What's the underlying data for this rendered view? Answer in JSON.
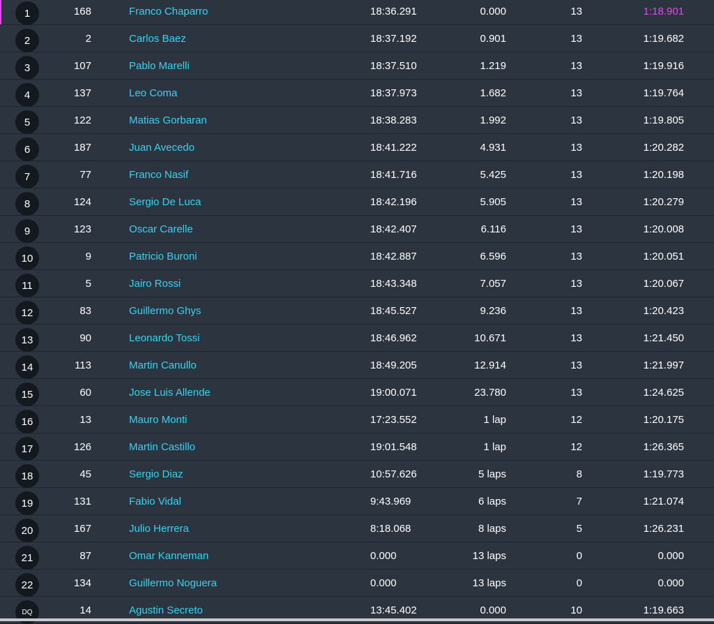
{
  "colors": {
    "background": "#2c3440",
    "driver_name": "#35d3f0",
    "fastest_lap": "#e844e8",
    "position_badge": "#141920"
  },
  "results": [
    {
      "pos": "1",
      "number": "168",
      "driver": "Franco Chaparro",
      "time": "18:36.291",
      "gap": "0.000",
      "laps": "13",
      "best_lap": "1:18.901",
      "fastest": true
    },
    {
      "pos": "2",
      "number": "2",
      "driver": "Carlos Baez",
      "time": "18:37.192",
      "gap": "0.901",
      "laps": "13",
      "best_lap": "1:19.682"
    },
    {
      "pos": "3",
      "number": "107",
      "driver": "Pablo Marelli",
      "time": "18:37.510",
      "gap": "1.219",
      "laps": "13",
      "best_lap": "1:19.916"
    },
    {
      "pos": "4",
      "number": "137",
      "driver": "Leo Coma",
      "time": "18:37.973",
      "gap": "1.682",
      "laps": "13",
      "best_lap": "1:19.764"
    },
    {
      "pos": "5",
      "number": "122",
      "driver": "Matias Gorbaran",
      "time": "18:38.283",
      "gap": "1.992",
      "laps": "13",
      "best_lap": "1:19.805"
    },
    {
      "pos": "6",
      "number": "187",
      "driver": "Juan Avecedo",
      "time": "18:41.222",
      "gap": "4.931",
      "laps": "13",
      "best_lap": "1:20.282"
    },
    {
      "pos": "7",
      "number": "77",
      "driver": "Franco Nasif",
      "time": "18:41.716",
      "gap": "5.425",
      "laps": "13",
      "best_lap": "1:20.198"
    },
    {
      "pos": "8",
      "number": "124",
      "driver": "Sergio De Luca",
      "time": "18:42.196",
      "gap": "5.905",
      "laps": "13",
      "best_lap": "1:20.279"
    },
    {
      "pos": "9",
      "number": "123",
      "driver": "Oscar Carelle",
      "time": "18:42.407",
      "gap": "6.116",
      "laps": "13",
      "best_lap": "1:20.008"
    },
    {
      "pos": "10",
      "number": "9",
      "driver": "Patricio Buroni",
      "time": "18:42.887",
      "gap": "6.596",
      "laps": "13",
      "best_lap": "1:20.051"
    },
    {
      "pos": "11",
      "number": "5",
      "driver": "Jairo Rossi",
      "time": "18:43.348",
      "gap": "7.057",
      "laps": "13",
      "best_lap": "1:20.067"
    },
    {
      "pos": "12",
      "number": "83",
      "driver": "Guillermo Ghys",
      "time": "18:45.527",
      "gap": "9.236",
      "laps": "13",
      "best_lap": "1:20.423"
    },
    {
      "pos": "13",
      "number": "90",
      "driver": "Leonardo Tossi",
      "time": "18:46.962",
      "gap": "10.671",
      "laps": "13",
      "best_lap": "1:21.450"
    },
    {
      "pos": "14",
      "number": "113",
      "driver": "Martin Canullo",
      "time": "18:49.205",
      "gap": "12.914",
      "laps": "13",
      "best_lap": "1:21.997"
    },
    {
      "pos": "15",
      "number": "60",
      "driver": "Jose Luis Allende",
      "time": "19:00.071",
      "gap": "23.780",
      "laps": "13",
      "best_lap": "1:24.625"
    },
    {
      "pos": "16",
      "number": "13",
      "driver": "Mauro Monti",
      "time": "17:23.552",
      "gap": "1 lap",
      "laps": "12",
      "best_lap": "1:20.175"
    },
    {
      "pos": "17",
      "number": "126",
      "driver": "Martin Castillo",
      "time": "19:01.548",
      "gap": "1 lap",
      "laps": "12",
      "best_lap": "1:26.365"
    },
    {
      "pos": "18",
      "number": "45",
      "driver": "Sergio Diaz",
      "time": "10:57.626",
      "gap": "5 laps",
      "laps": "8",
      "best_lap": "1:19.773"
    },
    {
      "pos": "19",
      "number": "131",
      "driver": "Fabio Vidal",
      "time": "9:43.969",
      "gap": "6 laps",
      "laps": "7",
      "best_lap": "1:21.074"
    },
    {
      "pos": "20",
      "number": "167",
      "driver": "Julio Herrera",
      "time": "8:18.068",
      "gap": "8 laps",
      "laps": "5",
      "best_lap": "1:26.231"
    },
    {
      "pos": "21",
      "number": "87",
      "driver": "Omar Kanneman",
      "time": "0.000",
      "gap": "13 laps",
      "laps": "0",
      "best_lap": "0.000"
    },
    {
      "pos": "22",
      "number": "134",
      "driver": "Guillermo Noguera",
      "time": "0.000",
      "gap": "13 laps",
      "laps": "0",
      "best_lap": "0.000"
    },
    {
      "pos": "DQ",
      "number": "14",
      "driver": "Agustin Secreto",
      "time": "13:45.402",
      "gap": "0.000",
      "laps": "10",
      "best_lap": "1:19.663"
    }
  ]
}
